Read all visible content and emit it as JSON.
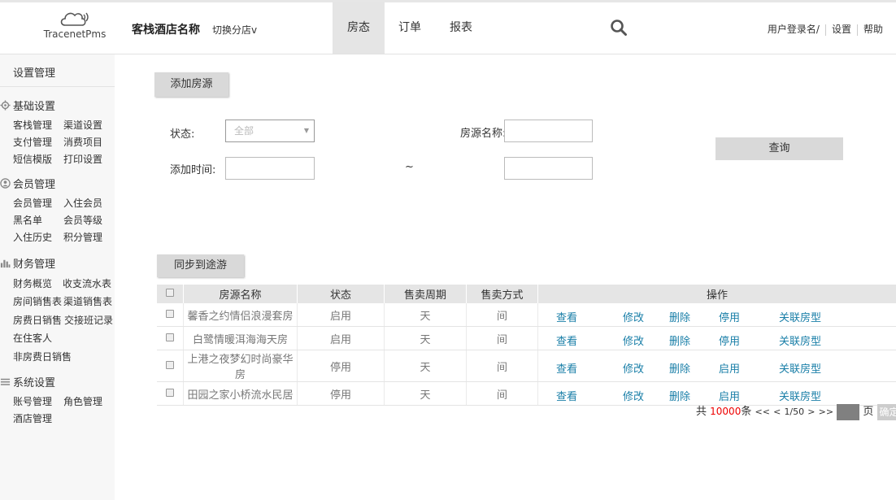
{
  "header": {
    "logo_text": "TracenetPms",
    "hotel_name": "客栈酒店名称",
    "switch_branch": "切换分店v",
    "tabs": [
      {
        "label": "房态",
        "active": true
      },
      {
        "label": "订单",
        "active": false
      },
      {
        "label": "报表",
        "active": false
      }
    ],
    "user_login": "用户登录名/",
    "settings": "设置",
    "help": "帮助",
    "search_icon": "search-icon"
  },
  "sidebar": {
    "title": "设置管理",
    "groups": [
      {
        "title": "基础设置",
        "icon": "gear-icon",
        "items": [
          "客栈管理",
          "渠道设置",
          "支付管理",
          "消费项目",
          "短信模版",
          "打印设置"
        ]
      },
      {
        "title": "会员管理",
        "icon": "user-icon",
        "items": [
          "会员管理",
          "入住会员",
          "黑名单",
          "会员等级",
          "入住历史",
          "积分管理"
        ]
      },
      {
        "title": "财务管理",
        "icon": "bar-chart-icon",
        "items": [
          "财务概览",
          "收支流水表",
          "房间销售表",
          "渠道销售表",
          "房费日销售",
          "交接班记录",
          "在住客人",
          "非房费日销售"
        ]
      },
      {
        "title": "系统设置",
        "icon": "menu-icon",
        "items": [
          "账号管理",
          "角色管理",
          "酒店管理"
        ]
      }
    ]
  },
  "main": {
    "add_button": "添加房源",
    "filters": {
      "status_label": "状态:",
      "status_value": "全部",
      "add_time_label": "添加时间:",
      "range_sep": "~",
      "room_name_label": "房源名称:",
      "query_button": "查询"
    },
    "sync_button": "同步到途游",
    "table": {
      "headers": [
        "房源名称",
        "状态",
        "售卖周期",
        "售卖方式",
        "操作"
      ],
      "rows": [
        {
          "name": "馨香之约情侣浪漫套房",
          "status": "启用",
          "period": "天",
          "mode": "间",
          "ops": [
            "查看",
            "修改",
            "删除",
            "停用",
            "关联房型"
          ]
        },
        {
          "name": "白鹭情暖洱海海天房",
          "status": "启用",
          "period": "天",
          "mode": "间",
          "ops": [
            "查看",
            "修改",
            "删除",
            "停用",
            "关联房型"
          ]
        },
        {
          "name": "上港之夜梦幻时尚豪华房",
          "status": "停用",
          "period": "天",
          "mode": "间",
          "ops": [
            "查看",
            "修改",
            "删除",
            "启用",
            "关联房型"
          ]
        },
        {
          "name": "田园之家小桥流水民居",
          "status": "停用",
          "period": "天",
          "mode": "间",
          "ops": [
            "查看",
            "修改",
            "删除",
            "启用",
            "关联房型"
          ]
        }
      ]
    },
    "pager": {
      "total_prefix": "共",
      "total_count": "10000",
      "total_suffix": "条",
      "first": "<<",
      "prev": "<",
      "page_info": "1/50",
      "next": ">",
      "last": ">>",
      "page_unit": "页",
      "confirm": "确定"
    }
  },
  "colors": {
    "link": "#1a7fa8",
    "count_red": "#e00000",
    "tab_active_bg": "#e5e5e5",
    "button_gray": "#d9d9d9"
  }
}
